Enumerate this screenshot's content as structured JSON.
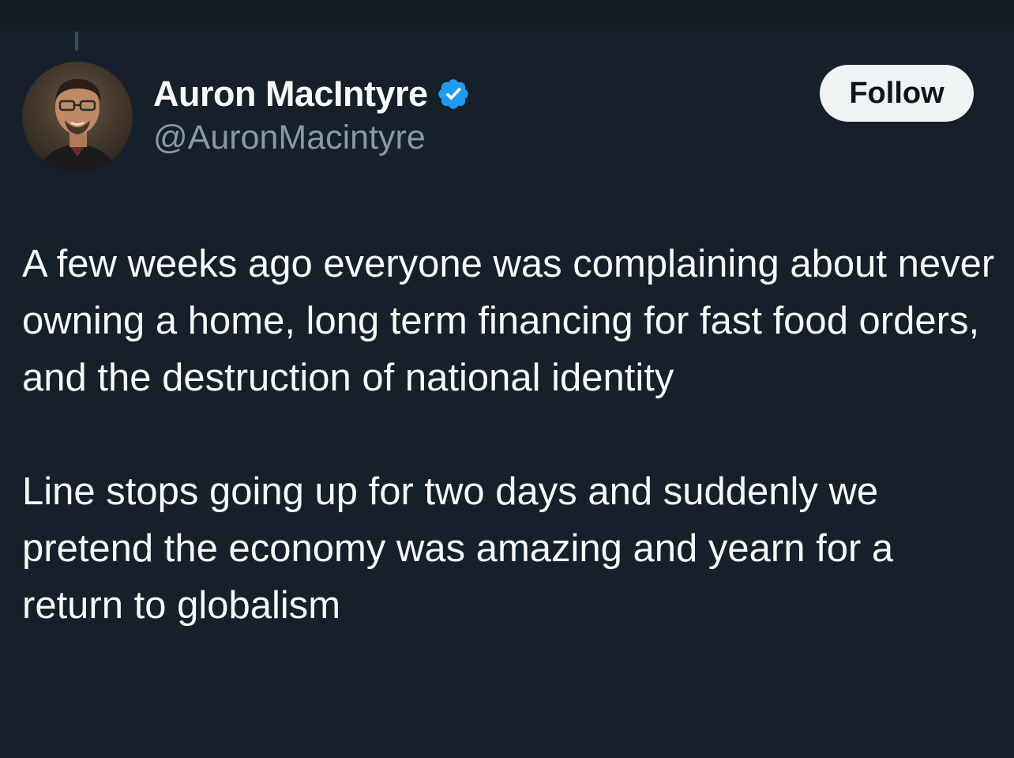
{
  "author": {
    "display_name": "Auron MacIntyre",
    "handle": "@AuronMacintyre",
    "verified": true,
    "verified_color": "#1d9bf0",
    "avatar_icon": "user-avatar-photo"
  },
  "follow_button": {
    "label": "Follow"
  },
  "tweet": {
    "paragraphs": [
      "A few weeks ago everyone was complaining about never owning a home, long term financing for fast food orders, and the destruction of national identity",
      "Line stops going up for two days and suddenly we pretend the economy was amazing and yearn for a return to globalism"
    ]
  },
  "colors": {
    "background": "#15202b",
    "text_primary": "#f7f9f9",
    "text_secondary": "#8b98a5",
    "button_bg": "#eff3f4",
    "button_text": "#0f1419"
  }
}
